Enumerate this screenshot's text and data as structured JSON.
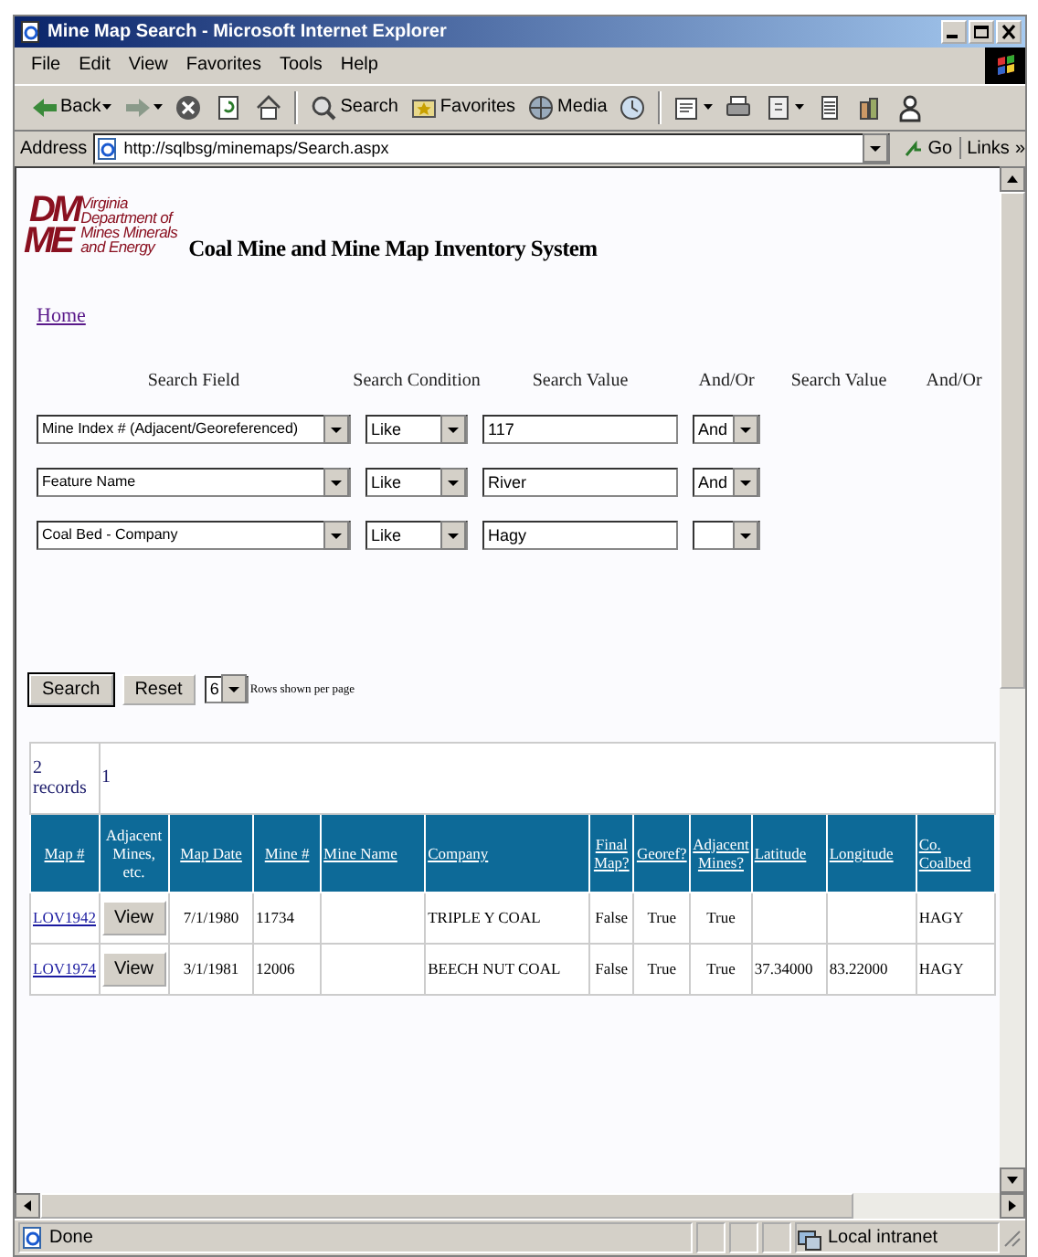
{
  "window": {
    "title": "Mine Map Search - Microsoft Internet Explorer"
  },
  "menu": [
    {
      "label": "File"
    },
    {
      "label": "Edit"
    },
    {
      "label": "View"
    },
    {
      "label": "Favorites"
    },
    {
      "label": "Tools"
    },
    {
      "label": "Help"
    }
  ],
  "toolbar": [
    {
      "kind": "back",
      "label": "Back",
      "menu": true
    },
    {
      "kind": "forward",
      "menu": true
    },
    {
      "kind": "stop",
      "menu": false
    },
    {
      "kind": "refresh",
      "menu": false
    },
    {
      "kind": "home",
      "menu": false
    },
    {
      "kind": "search",
      "label": "Search",
      "menu": false
    },
    {
      "kind": "favorites",
      "label": "Favorites",
      "menu": false
    },
    {
      "kind": "media",
      "label": "Media",
      "menu": false
    },
    {
      "kind": "history",
      "menu": false
    },
    {
      "kind": "mail",
      "menu": true
    },
    {
      "kind": "print",
      "menu": false
    },
    {
      "kind": "edit",
      "menu": true
    },
    {
      "kind": "discuss",
      "menu": false
    },
    {
      "kind": "research",
      "menu": false
    },
    {
      "kind": "messenger",
      "menu": false
    }
  ],
  "address": {
    "label": "Address",
    "value": "http://sqlbsg/minemaps/Search.aspx",
    "go": "Go",
    "links": "Links",
    "more": "»"
  },
  "page": {
    "logo_letters": [
      "DM",
      "ME"
    ],
    "logo_lines": [
      "Virginia",
      "Department of",
      "Mines Minerals",
      "and Energy"
    ],
    "title": "Coal Mine and Mine Map Inventory System",
    "home_link": "Home",
    "search_headers": [
      "Search Field",
      "Search Condition",
      "Search Value",
      "And/Or",
      "Search Value",
      "And/Or"
    ],
    "criteria": [
      {
        "field": "Mine Index # (Adjacent/Georeferenced)",
        "condition": "Like",
        "value": "117",
        "andor": "And"
      },
      {
        "field": "Feature Name",
        "condition": "Like",
        "value": "River",
        "andor": "And"
      },
      {
        "field": "Coal Bed - Company",
        "condition": "Like",
        "value": "Hagy"
      }
    ],
    "search_button": "Search",
    "reset_button": "Reset",
    "rows_per_page": "6",
    "rows_per_page_label": "Rows shown per page",
    "results": {
      "count": "2 records",
      "pages": [
        {
          "label": "1",
          "selected": true
        }
      ],
      "columns": [
        {
          "label": "Map #",
          "sortable": true,
          "kind": "link"
        },
        {
          "label": "Adjacent Mines, etc.",
          "sortable": false,
          "kind": "button"
        },
        {
          "label": "Map Date",
          "sortable": true,
          "kind": "text"
        },
        {
          "label": "Mine #",
          "sortable": true,
          "kind": "text"
        },
        {
          "label": "Mine Name",
          "sortable": true,
          "kind": "text"
        },
        {
          "label": "Company",
          "sortable": true,
          "kind": "text"
        },
        {
          "label": "Final Map?",
          "sortable": true,
          "kind": "text"
        },
        {
          "label": "Georef?",
          "sortable": true,
          "kind": "text"
        },
        {
          "label": "Adjacent Mines?",
          "sortable": true,
          "kind": "text"
        },
        {
          "label": "Latitude",
          "sortable": true,
          "kind": "text"
        },
        {
          "label": "Longitude",
          "sortable": true,
          "kind": "text"
        },
        {
          "label": "Co. Coalbed",
          "sortable": true,
          "kind": "text"
        }
      ],
      "rows": [
        [
          "LOV1942",
          "View",
          "7/1/1980",
          "11734",
          null,
          "TRIPLE Y COAL",
          "False",
          "True",
          "True",
          null,
          null,
          "HAGY"
        ],
        [
          "LOV1974",
          "View",
          "3/1/1981",
          "12006",
          null,
          "BEECH NUT COAL",
          "False",
          "True",
          "True",
          "37.34000",
          "83.22000",
          "HAGY"
        ]
      ]
    }
  },
  "status_bar": {
    "text": "Done",
    "zone": "Local intranet"
  }
}
